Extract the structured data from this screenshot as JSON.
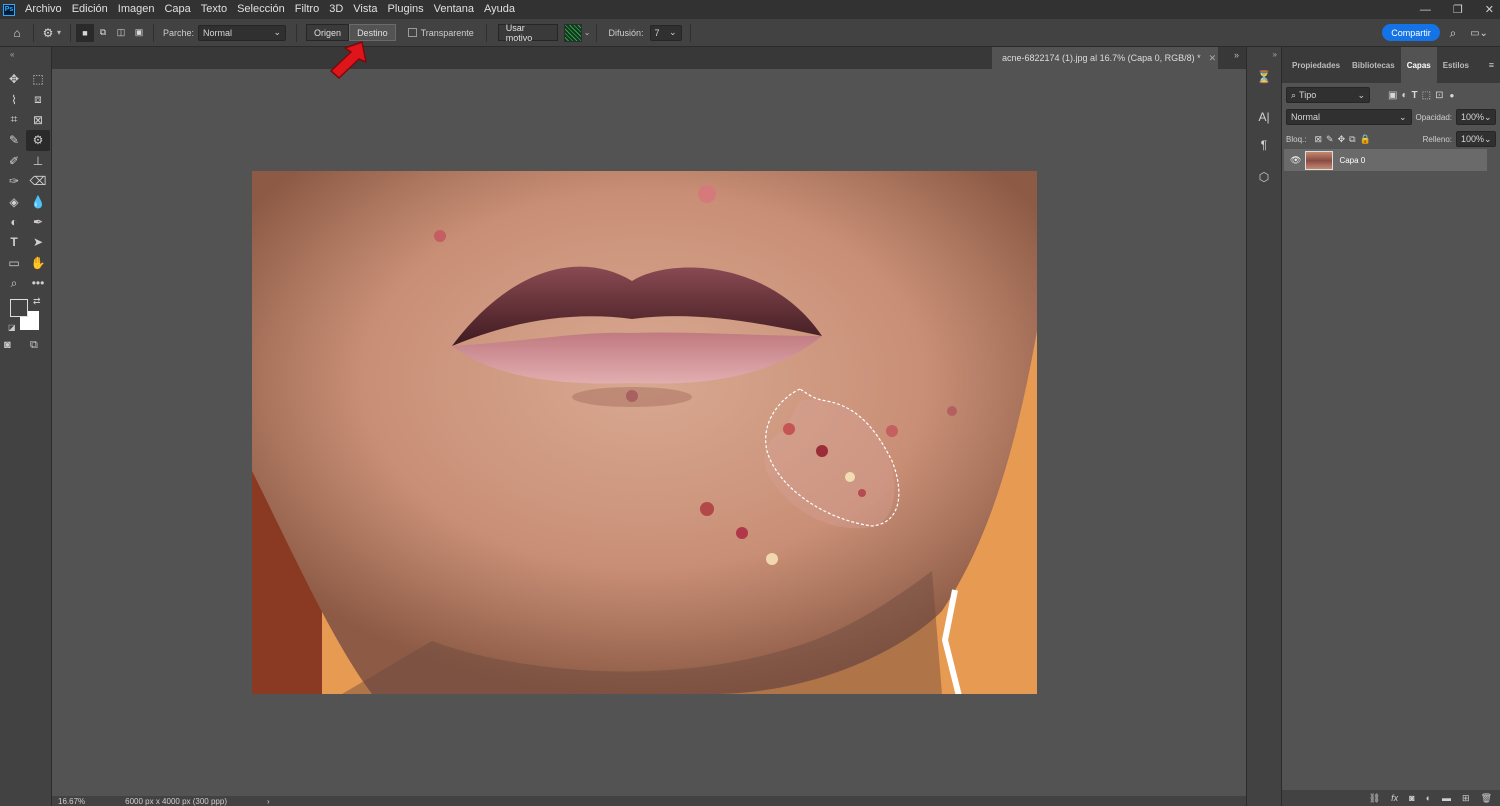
{
  "menubar": {
    "logo": "Ps",
    "items": [
      "Archivo",
      "Edición",
      "Imagen",
      "Capa",
      "Texto",
      "Selección",
      "Filtro",
      "3D",
      "Vista",
      "Plugins",
      "Ventana",
      "Ayuda"
    ]
  },
  "options_bar": {
    "patch_label": "Parche:",
    "patch_value": "Normal",
    "origin_label": "Origen",
    "dest_label": "Destino",
    "transparent_label": "Transparente",
    "use_pattern_label": "Usar motivo",
    "diffusion_label": "Difusión:",
    "diffusion_value": "7",
    "share_label": "Compartir"
  },
  "document": {
    "tab_title": "acne-6822174 (1).jpg al 16.7% (Capa 0, RGB/8) *",
    "zoom": "16.67%",
    "doc_info": "6000 px x 4000 px (300 ppp)"
  },
  "panel": {
    "tabs": [
      "Propiedades",
      "Bibliotecas",
      "Capas",
      "Estilos"
    ],
    "active_tab": "Capas",
    "filter_value": "Tipo",
    "blend_mode": "Normal",
    "opacity_label": "Opacidad:",
    "opacity_value": "100%",
    "lock_label": "Bloq.:",
    "fill_label": "Relleno:",
    "fill_value": "100%",
    "layer_name": "Capa 0"
  },
  "colors": {
    "accent": "#1473e6",
    "arrow": "#e0151b",
    "selection": "#ffffff"
  }
}
